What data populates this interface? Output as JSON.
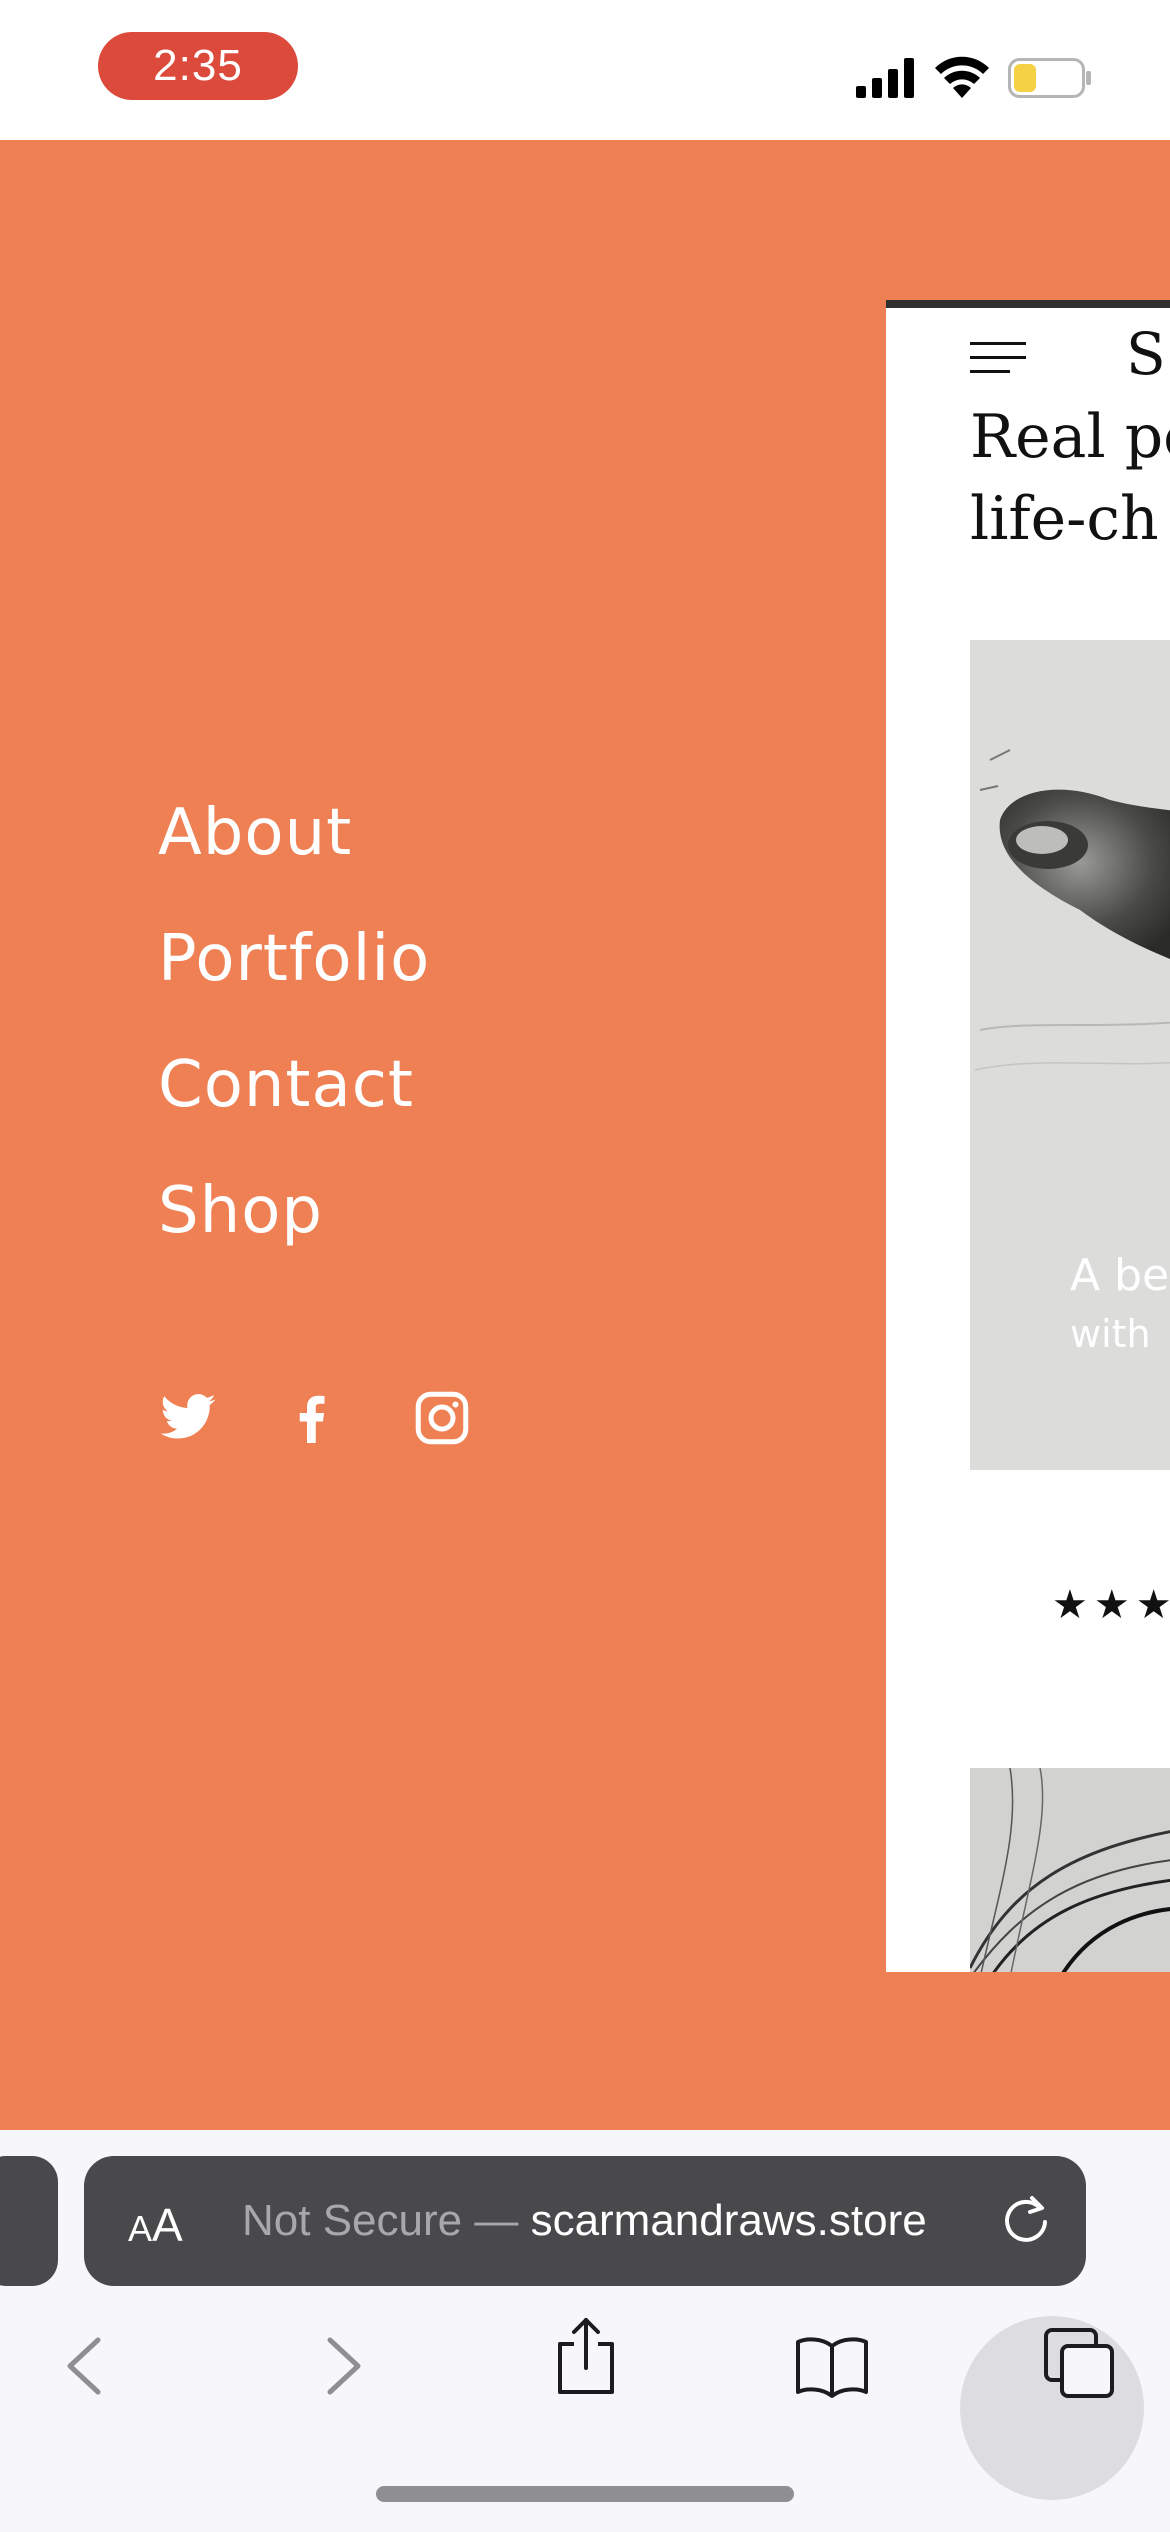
{
  "status_bar": {
    "time": "2:35",
    "time_pill_color": "#dc4a3c",
    "icons": [
      "cellular-signal-icon",
      "wifi-icon",
      "battery-icon"
    ],
    "battery_level": 0.35,
    "battery_color": "#f5d146"
  },
  "menu": {
    "background_color": "#ee8054",
    "items": [
      {
        "label": "About"
      },
      {
        "label": "Portfolio"
      },
      {
        "label": "Contact"
      },
      {
        "label": "Shop"
      }
    ],
    "social": [
      "twitter-icon",
      "facebook-icon",
      "instagram-icon"
    ]
  },
  "page_preview": {
    "logo": "S",
    "heading_line1": "Real pe",
    "heading_line2": "life-ch",
    "hero_caption_line1": "A be",
    "hero_caption_line2": "with",
    "rating": "★★★"
  },
  "safari": {
    "text_size_label_small": "A",
    "text_size_label_big": "A",
    "url_prefix": "Not Secure — ",
    "url_domain": "scarmandraws.store",
    "toolbar": [
      "back-icon",
      "forward-icon",
      "share-icon",
      "bookmarks-icon",
      "tabs-icon"
    ]
  }
}
